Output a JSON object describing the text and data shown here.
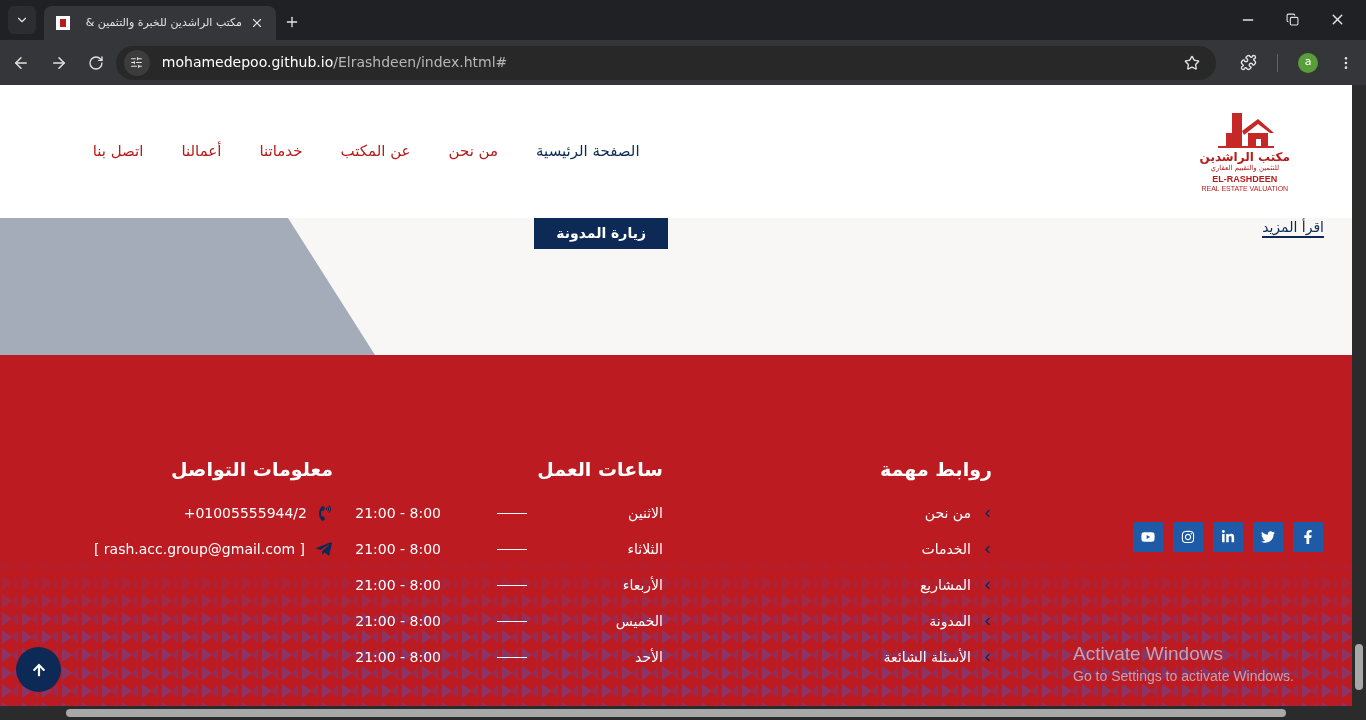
{
  "browser": {
    "tab_title": "مكتب الراشدين للخبرة والتثمين &",
    "url_host": "mohamedepoo.github.io",
    "url_path": "/Elrashdeen/index.html#",
    "profile_initial": "a"
  },
  "logo": {
    "title": "مكتب الراشدين",
    "subtitle": "للتثمين والتقييم العقاري",
    "name_en": "EL-RASHDEEN",
    "tagline_en": "REAL ESTATE VALUATION"
  },
  "nav": {
    "items": [
      {
        "label": "الصفحة الرئيسية",
        "selected": true
      },
      {
        "label": "من نحن",
        "selected": false
      },
      {
        "label": "عن المكتب",
        "selected": false
      },
      {
        "label": "خدماتنا",
        "selected": false
      },
      {
        "label": "أعمالنا",
        "selected": false
      },
      {
        "label": "اتصل بنا",
        "selected": false
      }
    ]
  },
  "section": {
    "read_more": "اقرأ المزيد",
    "blog_button": "زيارة المدونة"
  },
  "footer": {
    "social": [
      {
        "kind": "facebook"
      },
      {
        "kind": "twitter"
      },
      {
        "kind": "linkedin"
      },
      {
        "kind": "instagram"
      },
      {
        "kind": "youtube"
      }
    ],
    "links": {
      "title": "روابط مهمة",
      "items": [
        "من نحن",
        "الخدمات",
        "المشاريع",
        "المدونة",
        "الأسئلة الشائعة"
      ]
    },
    "hours": {
      "title": "ساعات العمل",
      "rows": [
        {
          "day": "الاثنين",
          "time": "8:00 - 21:00"
        },
        {
          "day": "الثلاثاء",
          "time": "8:00 - 21:00"
        },
        {
          "day": "الأربعاء",
          "time": "8:00 - 21:00"
        },
        {
          "day": "الخميس",
          "time": "8:00 - 21:00"
        },
        {
          "day": "الأحد",
          "time": "8:00 - 21:00"
        }
      ]
    },
    "contact": {
      "title": "معلومات التواصل",
      "items": [
        {
          "kind": "phone",
          "text": "+01005555944/2"
        },
        {
          "kind": "email",
          "text": "[ rash.acc.group@gmail.com ]"
        }
      ]
    }
  },
  "os_notice": {
    "title": "Activate Windows",
    "text": "Go to Settings to activate Windows."
  }
}
